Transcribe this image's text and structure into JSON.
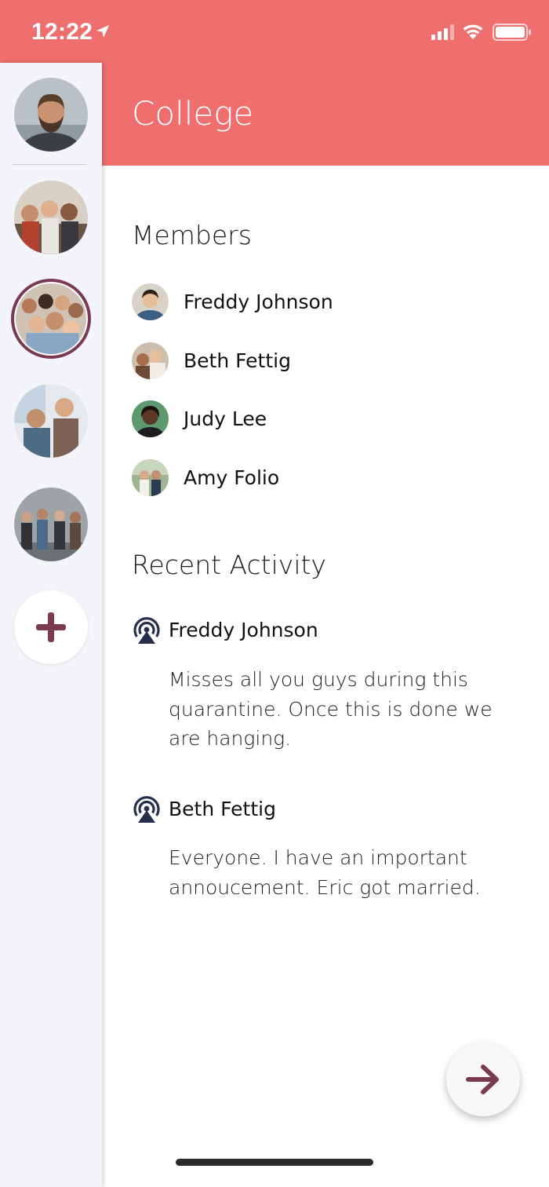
{
  "status_bar": {
    "time": "12:22"
  },
  "header": {
    "title": "College"
  },
  "sidebar": {
    "avatars": [
      {
        "name": "profile-avatar",
        "selected": false
      },
      {
        "name": "group-avatar-1",
        "selected": false
      },
      {
        "name": "group-avatar-college",
        "selected": true
      },
      {
        "name": "group-avatar-3",
        "selected": false
      },
      {
        "name": "group-avatar-4",
        "selected": false
      }
    ],
    "add_icon": "plus-icon"
  },
  "members": {
    "title": "Members",
    "items": [
      {
        "name": "Freddy Johnson"
      },
      {
        "name": "Beth Fettig"
      },
      {
        "name": "Judy Lee"
      },
      {
        "name": "Amy Folio"
      }
    ]
  },
  "recent_activity": {
    "title": "Recent Activity",
    "items": [
      {
        "name": "Freddy Johnson",
        "text": "Misses all you guys during this quarantine.  Once this is done we are hanging."
      },
      {
        "name": "Beth Fettig",
        "text": "Everyone. I have an important annoucement.  Eric got married."
      }
    ]
  },
  "colors": {
    "header": "#ee6f6e",
    "accent": "#7a3a52",
    "sidebar": "#f4f5fb",
    "activity_icon": "#26304d"
  },
  "next_button": {
    "icon": "arrow-right-icon"
  }
}
